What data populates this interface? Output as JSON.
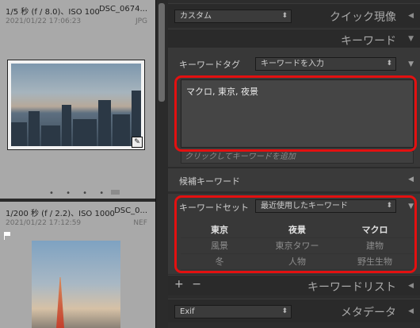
{
  "grid": {
    "cell1": {
      "info": "1/5 秒 (f / 8.0)、ISO 100",
      "name": "DSC_0674...",
      "date": "2021/01/22 17:06:23",
      "type": "JPG",
      "dots": "• • • • •"
    },
    "cell2": {
      "info": "1/200 秒 (f / 2.2)、ISO 1000",
      "name": "DSC_0...",
      "date": "2021/01/22 17:12:59",
      "type": "NEF"
    }
  },
  "panel": {
    "preset_value": "カスタム",
    "quick_develop": "クイック現像",
    "keyword_title": "キーワード",
    "tag_label": "キーワードタグ",
    "tag_select": "キーワードを入力",
    "keywords_text": "マクロ, 東京, 夜景",
    "add_placeholder": "クリックしてキーワードを追加",
    "suggestions_label": "候補キーワード",
    "set_label": "キーワードセット",
    "set_select": "最近使用したキーワード",
    "keyword_grid": [
      [
        "東京",
        "夜景",
        "マクロ"
      ],
      [
        "風景",
        "東京タワー",
        "建物"
      ],
      [
        "冬",
        "人物",
        "野生生物"
      ]
    ],
    "plus": "+",
    "minus": "−",
    "keyword_list": "キーワードリスト",
    "metadata_select": "Exif",
    "metadata_title": "メタデータ"
  },
  "colors": {
    "highlight": "#e31010",
    "panel_bg": "#2d2d2d",
    "grid_cell": "#a9a9a9"
  },
  "icons": {
    "collapse": "triangle-left-icon",
    "expand": "triangle-down-icon",
    "select": "up-down-arrows-icon",
    "badge": "develop-badge-icon"
  }
}
